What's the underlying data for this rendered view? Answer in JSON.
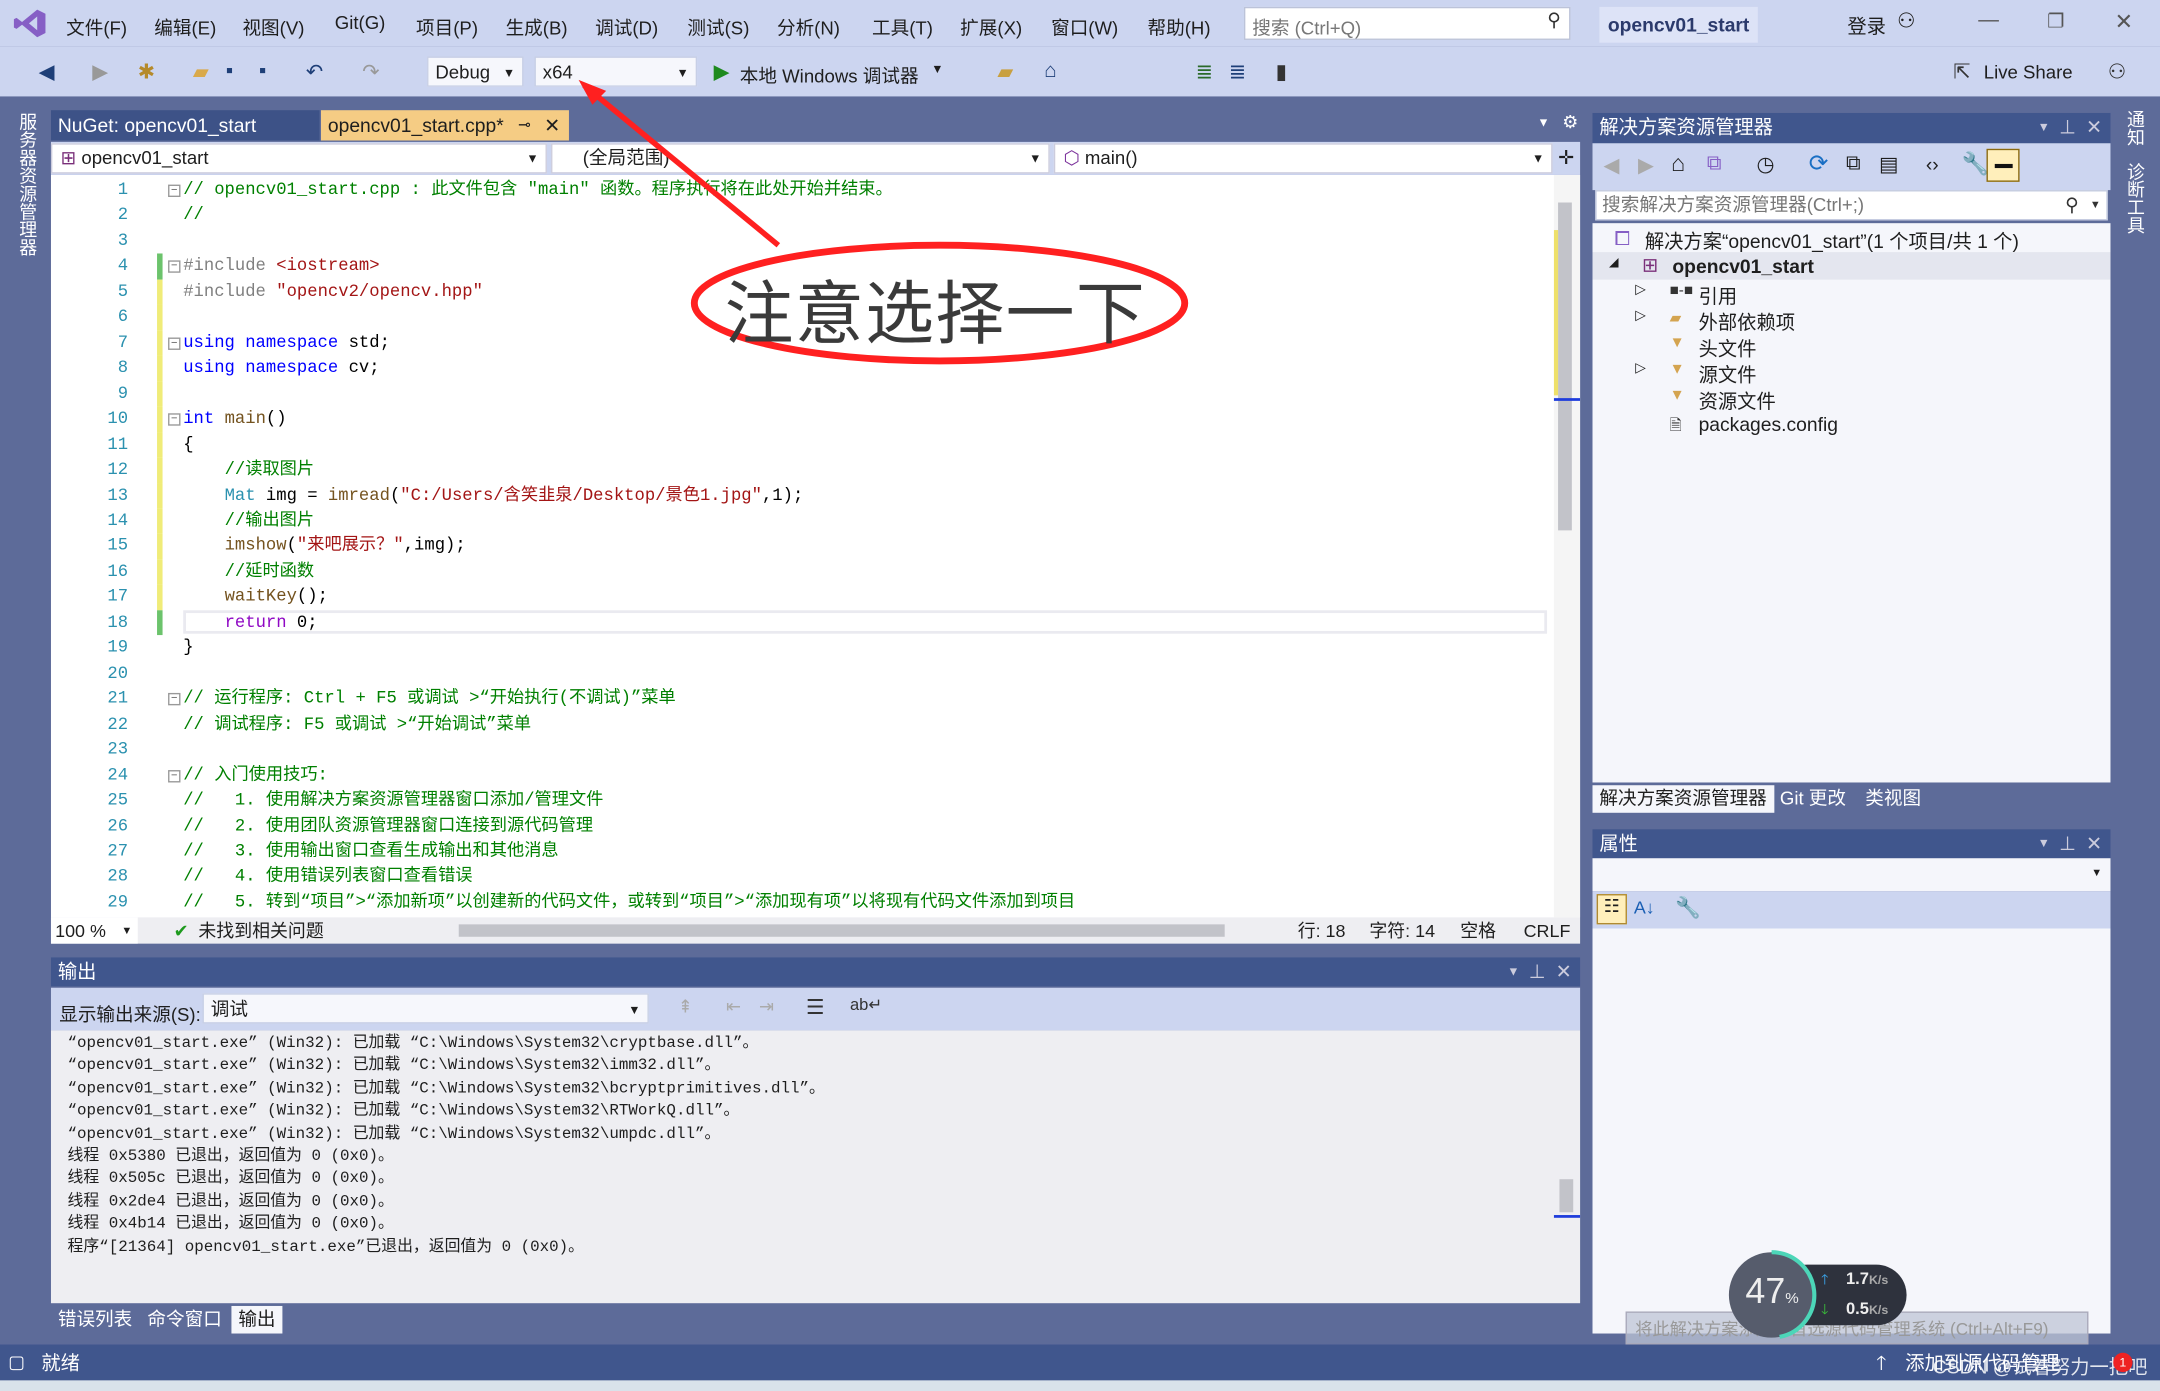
{
  "menu": {
    "items": [
      "文件(F)",
      "编辑(E)",
      "视图(V)",
      "Git(G)",
      "项目(P)",
      "生成(B)",
      "调试(D)",
      "测试(S)",
      "分析(N)",
      "工具(T)",
      "扩展(X)",
      "窗口(W)",
      "帮助(H)"
    ],
    "search_placeholder": "搜索 (Ctrl+Q)",
    "solution_name": "opencv01_start",
    "login": "登录"
  },
  "toolbar": {
    "config": "Debug",
    "platform": "x64",
    "run_label": "本地 Windows 调试器",
    "live_share": "Live Share"
  },
  "tabs": [
    {
      "label": "NuGet: opencv01_start"
    },
    {
      "label": "opencv01_start.cpp*",
      "active": true
    }
  ],
  "nav": {
    "project": "opencv01_start",
    "scope": "(全局范围)",
    "member": "main()"
  },
  "annotation": {
    "text": "注意选择一下",
    "color": "#ff2020"
  },
  "code": [
    [
      [
        "cm",
        "// opencv01_start.cpp : 此文件包含 \"main\" 函数。程序执行将在此处开始并结束。"
      ]
    ],
    [
      [
        "cm",
        "//"
      ]
    ],
    [],
    [
      [
        "pp",
        "#include "
      ],
      [
        "str",
        "<iostream>"
      ]
    ],
    [
      [
        "pp",
        "#include "
      ],
      [
        "str",
        "\"opencv2/opencv.hpp\""
      ]
    ],
    [],
    [
      [
        "kw",
        "using namespace "
      ],
      [
        "tx",
        "std;"
      ]
    ],
    [
      [
        "kw",
        "using namespace "
      ],
      [
        "tx",
        "cv;"
      ]
    ],
    [],
    [
      [
        "kw",
        "int "
      ],
      [
        "fn",
        "main"
      ],
      [
        "tx",
        "()"
      ]
    ],
    [
      [
        "tx",
        "{"
      ]
    ],
    [
      [
        "tx",
        "    "
      ],
      [
        "cm",
        "//读取图片"
      ]
    ],
    [
      [
        "tx",
        "    "
      ],
      [
        "ty",
        "Mat "
      ],
      [
        "tx",
        "img = "
      ],
      [
        "fn",
        "imread"
      ],
      [
        "tx",
        "("
      ],
      [
        "str",
        "\"C:/Users/含笑韭泉/Desktop/景色1.jpg\""
      ],
      [
        "tx",
        ",1);"
      ]
    ],
    [
      [
        "tx",
        "    "
      ],
      [
        "cm",
        "//输出图片"
      ]
    ],
    [
      [
        "tx",
        "    "
      ],
      [
        "fn",
        "imshow"
      ],
      [
        "tx",
        "("
      ],
      [
        "str",
        "\"来吧展示？\""
      ],
      [
        "tx",
        ",img);"
      ]
    ],
    [
      [
        "tx",
        "    "
      ],
      [
        "cm",
        "//延时函数"
      ]
    ],
    [
      [
        "tx",
        "    "
      ],
      [
        "fn",
        "waitKey"
      ],
      [
        "tx",
        "();"
      ]
    ],
    [
      [
        "tx",
        "    "
      ],
      [
        "ret",
        "return "
      ],
      [
        "tx",
        "0;"
      ]
    ],
    [
      [
        "tx",
        "}"
      ]
    ],
    [],
    [
      [
        "cm",
        "// 运行程序: Ctrl + F5 或调试 >“开始执行(不调试)”菜单"
      ]
    ],
    [
      [
        "cm",
        "// 调试程序: F5 或调试 >“开始调试”菜单"
      ]
    ],
    [],
    [
      [
        "cm",
        "// 入门使用技巧:"
      ]
    ],
    [
      [
        "cm",
        "//   1. 使用解决方案资源管理器窗口添加/管理文件"
      ]
    ],
    [
      [
        "cm",
        "//   2. 使用团队资源管理器窗口连接到源代码管理"
      ]
    ],
    [
      [
        "cm",
        "//   3. 使用输出窗口查看生成输出和其他消息"
      ]
    ],
    [
      [
        "cm",
        "//   4. 使用错误列表窗口查看错误"
      ]
    ],
    [
      [
        "cm",
        "//   5. 转到“项目”>“添加新项”以创建新的代码文件，或转到“项目”>“添加现有项”以将现有代码文件添加到项目"
      ]
    ]
  ],
  "editor_status": {
    "zoom": "100 %",
    "issues": "未找到相关问题",
    "line": "行: 18",
    "char": "字符: 14",
    "spaces": "空格",
    "eol": "CRLF"
  },
  "output": {
    "title": "输出",
    "source_label": "显示输出来源(S):",
    "source_value": "调试",
    "lines": [
      "“opencv01_start.exe” (Win32): 已加载 “C:\\Windows\\System32\\cryptbase.dll”。",
      "“opencv01_start.exe” (Win32): 已加载 “C:\\Windows\\System32\\imm32.dll”。",
      "“opencv01_start.exe” (Win32): 已加载 “C:\\Windows\\System32\\bcryptprimitives.dll”。",
      "“opencv01_start.exe” (Win32): 已加载 “C:\\Windows\\System32\\RTWorkQ.dll”。",
      "“opencv01_start.exe” (Win32): 已加载 “C:\\Windows\\System32\\umpdc.dll”。",
      "线程 0x5380 已退出，返回值为 0 (0x0)。",
      "线程 0x505c 已退出，返回值为 0 (0x0)。",
      "线程 0x2de4 已退出，返回值为 0 (0x0)。",
      "线程 0x4b14 已退出，返回值为 0 (0x0)。",
      "程序“[21364] opencv01_start.exe”已退出，返回值为 0 (0x0)。"
    ]
  },
  "bottom_tabs": [
    "错误列表",
    "命令窗口",
    "输出"
  ],
  "solution_explorer": {
    "title": "解决方案资源管理器",
    "search_placeholder": "搜索解决方案资源管理器(Ctrl+;)",
    "solution": "解决方案“opencv01_start”(1 个项目/共 1 个)",
    "project": "opencv01_start",
    "items": [
      {
        "label": "引用",
        "expandable": true
      },
      {
        "label": "外部依赖项",
        "expandable": true
      },
      {
        "label": "头文件",
        "expandable": false
      },
      {
        "label": "源文件",
        "expandable": true
      },
      {
        "label": "资源文件",
        "expandable": false
      },
      {
        "label": "packages.config",
        "expandable": false
      }
    ],
    "tabs": [
      "解决方案资源管理器",
      "Git 更改",
      "类视图"
    ]
  },
  "properties": {
    "title": "属性"
  },
  "side_left": "服务器资源管理器",
  "side_right": [
    "通知",
    "诊断工具"
  ],
  "status": {
    "ready": "就绪",
    "source_control": "添加到源代码管理",
    "tooltip": "将此解决方案添加到首选源代码管理系统 (Ctrl+Alt+F9)",
    "watermark": "CSDN @试着努力一把吧"
  },
  "net_widget": {
    "percent": "47",
    "pct_sign": "%",
    "percent_value": 47,
    "up": "1.7",
    "down": "0.5",
    "unit": "K/s"
  }
}
